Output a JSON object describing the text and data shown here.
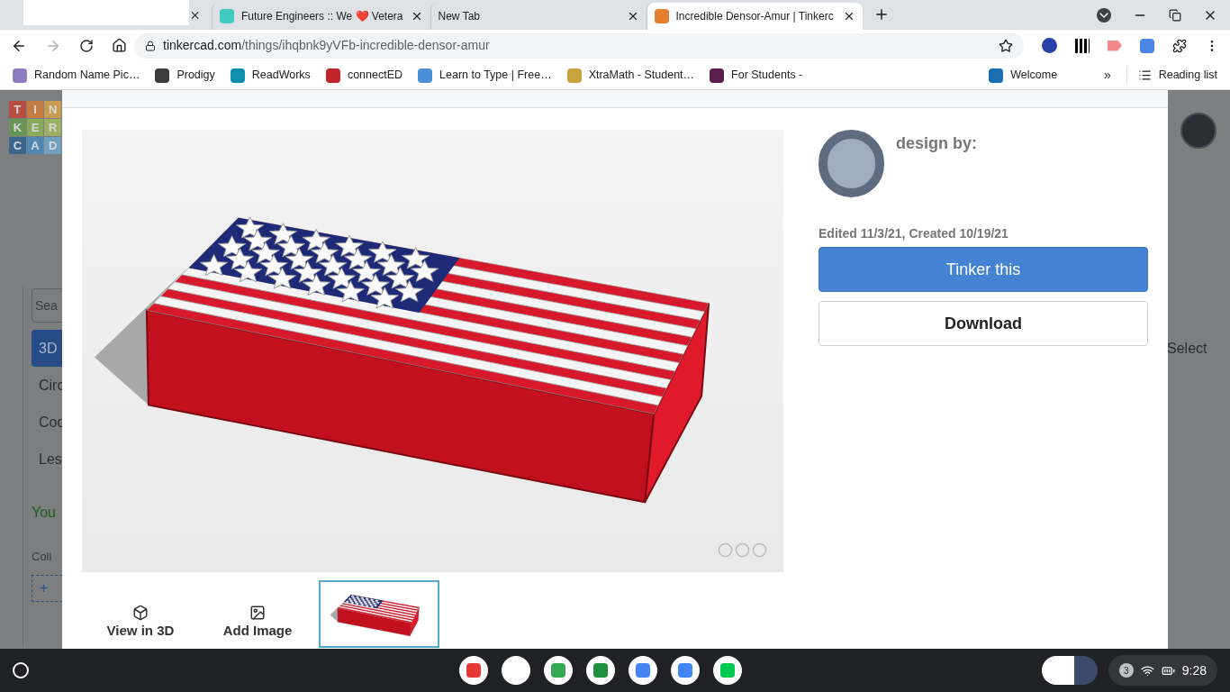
{
  "browser": {
    "tabs": [
      {
        "kind": "covered",
        "selected": false
      },
      {
        "kind": "page",
        "title": "Future Engineers :: We ❤️ Vetera",
        "selected": false
      },
      {
        "kind": "page",
        "title": "New Tab",
        "selected": false
      },
      {
        "kind": "page",
        "title": "Incredible Densor-Amur | Tinkerc",
        "selected": true
      }
    ],
    "address": {
      "domain": "tinkercad.com",
      "path": "/things/ihqbnk9yVFb-incredible-densor-amur"
    },
    "bookmarks": [
      {
        "label": "Random Name Pic…"
      },
      {
        "label": "Prodigy"
      },
      {
        "label": "ReadWorks"
      },
      {
        "label": "connectED"
      },
      {
        "label": "Learn to Type | Free…"
      },
      {
        "label": "XtraMath - Student…"
      },
      {
        "label": "For Students -"
      },
      {
        "label": "Welcome"
      }
    ],
    "more_bookmarks": "»",
    "reading_list": "Reading list"
  },
  "background": {
    "logo_letters": [
      "T",
      "I",
      "N",
      "K",
      "E",
      "R",
      "C",
      "A",
      "D"
    ],
    "search_placeholder": "Sea",
    "sidebar_items": [
      {
        "label": "3D",
        "selected": true
      },
      {
        "label": "Circ",
        "selected": false
      },
      {
        "label": "Cod",
        "selected": false
      },
      {
        "label": "Les",
        "selected": false
      }
    ],
    "status": "You",
    "collections_label": "Coll",
    "add_label": "+",
    "select_label": "Select"
  },
  "modal": {
    "designer_label": "design by:",
    "dates": "Edited 11/3/21, Created 10/19/21",
    "buttons": [
      {
        "kind": "primary",
        "label": "Tinker this"
      },
      {
        "kind": "secondary",
        "label": "Download"
      }
    ],
    "actions": [
      {
        "kind": "view3d",
        "label": "View in 3D"
      },
      {
        "kind": "image",
        "label": "Add Image"
      }
    ],
    "thumbnails": [
      {
        "selected": true
      }
    ]
  },
  "taskbar": {
    "notification_count": "3",
    "time": "9:28"
  }
}
